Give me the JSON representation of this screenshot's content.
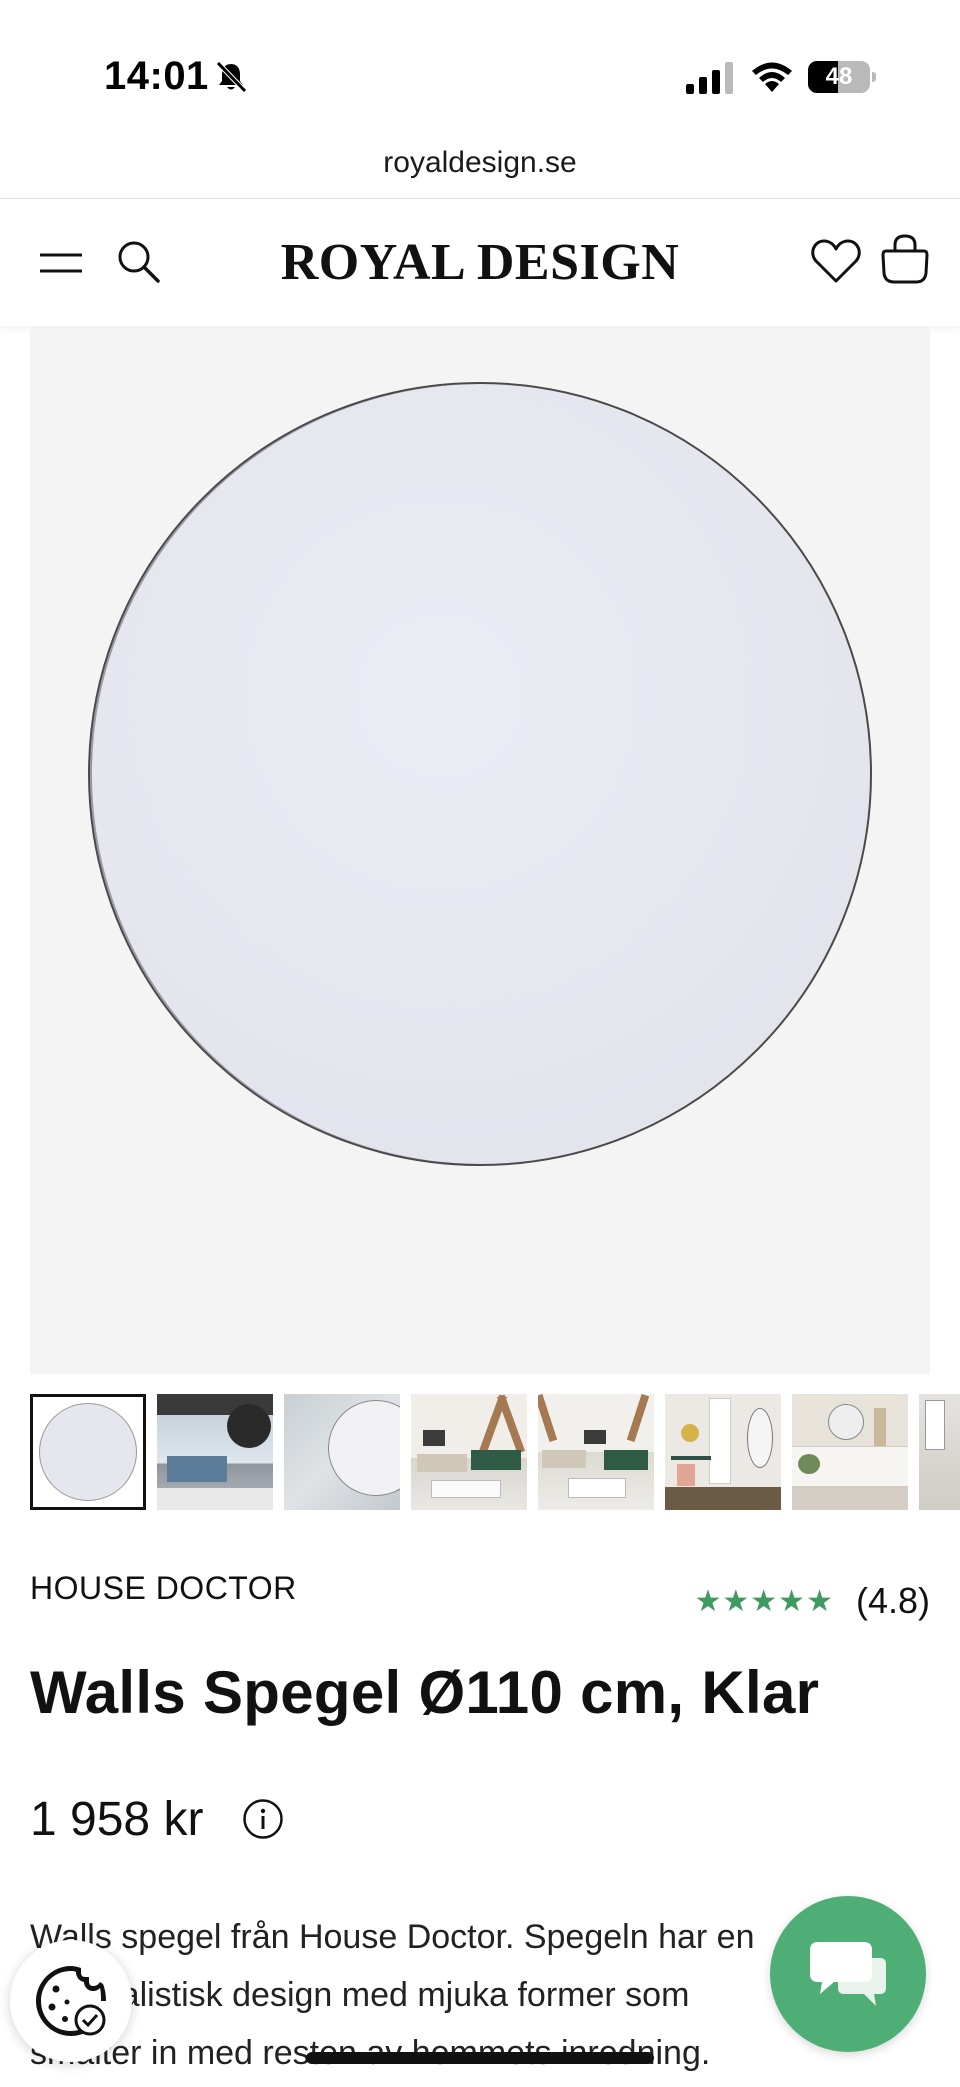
{
  "status_bar": {
    "time": "14:01",
    "battery": "48",
    "battery_level": 0.48
  },
  "browser": {
    "url": "royaldesign.se"
  },
  "header": {
    "logo": "ROYAL DESIGN",
    "icons": [
      "menu-icon",
      "search-icon",
      "heart-icon",
      "bag-icon"
    ]
  },
  "gallery": {
    "main_image": "round mirror",
    "thumbnails": [
      {
        "name": "mirror-front",
        "active": true
      },
      {
        "name": "living-room-window"
      },
      {
        "name": "mirror-on-concrete-wall"
      },
      {
        "name": "living-room-green-sofa"
      },
      {
        "name": "living-room-green-sofa-2"
      },
      {
        "name": "hallway-desk"
      },
      {
        "name": "living-room-white-sofa"
      },
      {
        "name": "partial-thumbnail"
      }
    ]
  },
  "product": {
    "brand": "HOUSE DOCTOR",
    "stars": "★★★★★",
    "rating": "(4.8)",
    "title": "Walls Spegel Ø110 cm, Klar",
    "price": "1 958 kr",
    "description_lines": [
      "Walls spegel från House Doctor. Spegeln har en",
      "minimalistisk design med mjuka former som",
      "smälter in med resten av hemmets inredning."
    ]
  },
  "colors": {
    "accent_green": "#4fad76",
    "stars_green": "#3f9a60"
  }
}
